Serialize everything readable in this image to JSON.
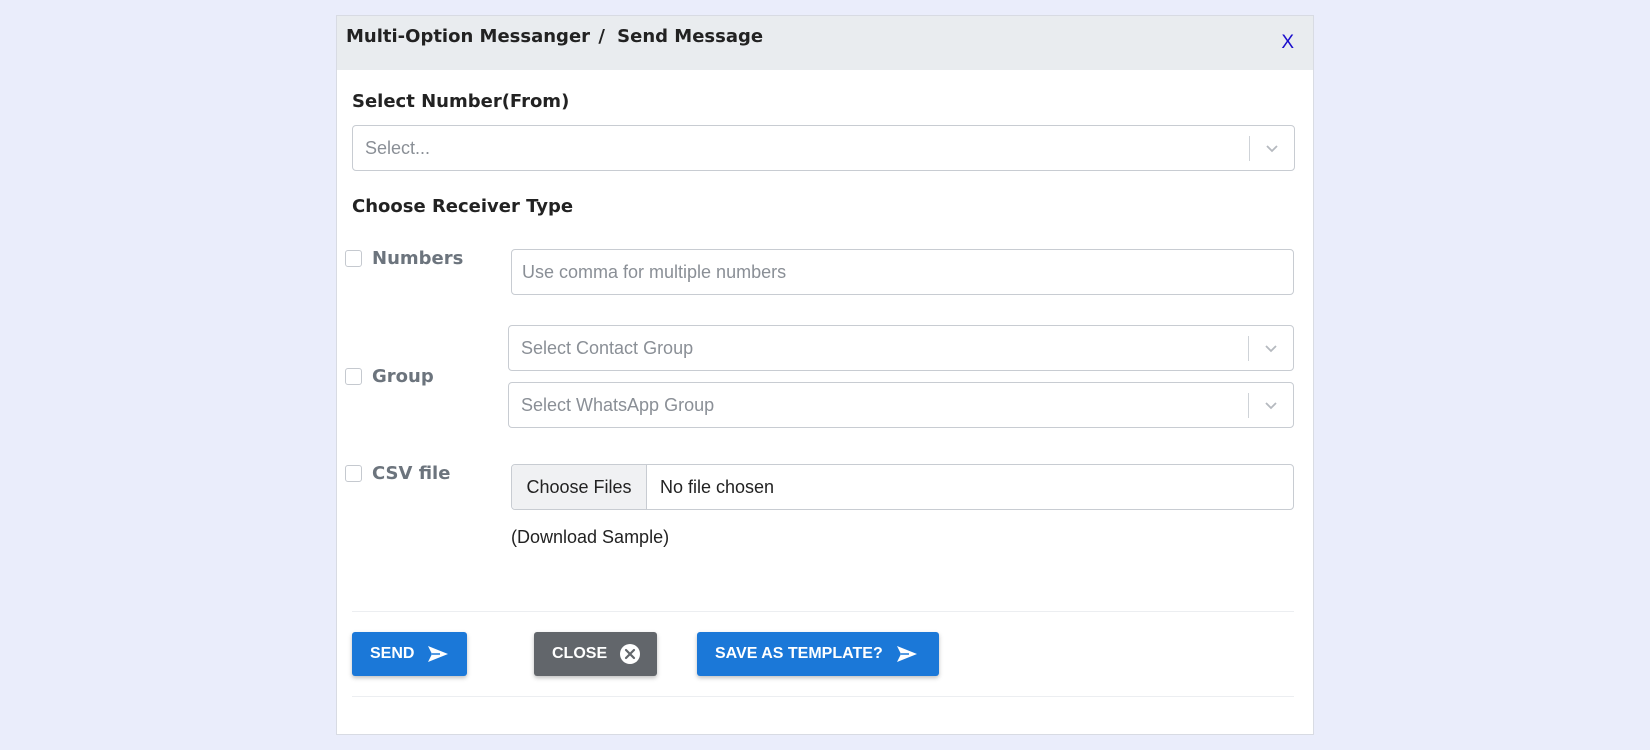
{
  "header": {
    "breadcrumb_root": "Multi-Option Messanger",
    "breadcrumb_separator": "/",
    "breadcrumb_current": "Send Message",
    "close_label": "X"
  },
  "from_section": {
    "label": "Select Number(From)",
    "select_placeholder": "Select..."
  },
  "receiver_section": {
    "label": "Choose Receiver Type",
    "numbers": {
      "label": "Numbers",
      "input_placeholder": "Use comma for multiple numbers"
    },
    "group": {
      "label": "Group",
      "contact_group_placeholder": "Select Contact Group",
      "whatsapp_group_placeholder": "Select WhatsApp Group"
    },
    "csv": {
      "label": "CSV file",
      "choose_files_label": "Choose Files",
      "file_status": "No file chosen",
      "download_sample_label": "(Download Sample)"
    }
  },
  "footer": {
    "send_label": "SEND",
    "close_label": "CLOSE",
    "save_template_label": "SAVE AS TEMPLATE?"
  },
  "colors": {
    "primary": "#1b78d8",
    "secondary": "#62666b",
    "header_bg": "#e9ecef",
    "page_bg": "#eaedfb",
    "close_x": "#1a0dcc"
  },
  "icons": {
    "send": "send-arrow-icon",
    "close": "circle-x-icon",
    "chevron": "chevron-down-icon"
  }
}
